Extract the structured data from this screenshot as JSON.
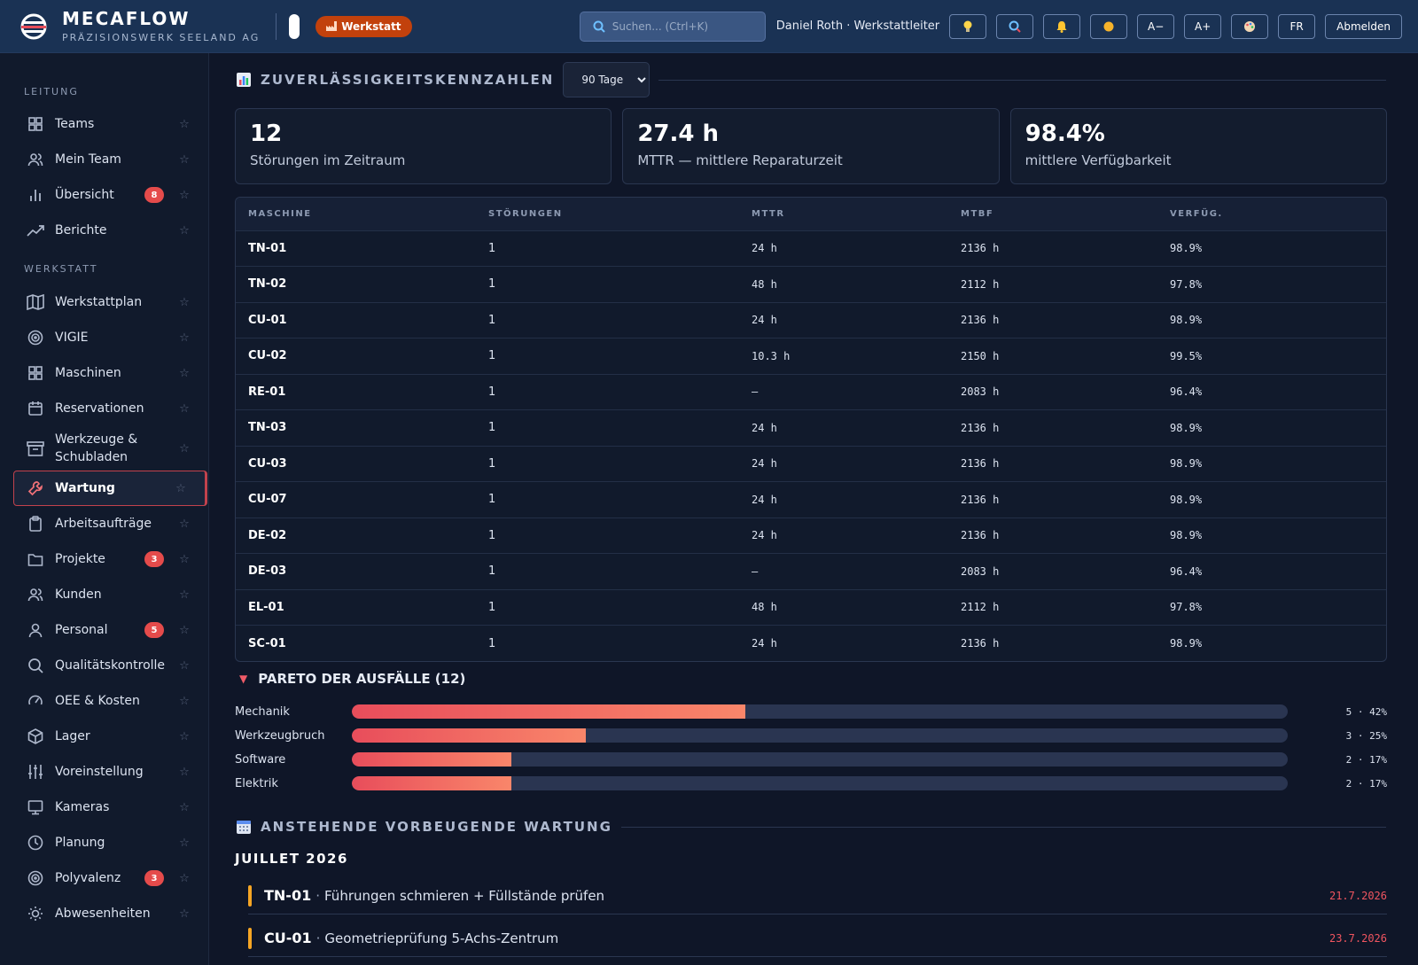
{
  "app": {
    "brand_name": "MECAFLOW",
    "brand_subtitle": "PRÄZISIONSWERK SEELAND AG",
    "context_badge": "Werkstatt",
    "search_placeholder": "Suchen... (Ctrl+K)",
    "user": "Daniel Roth · Werkstattleiter",
    "buttons": {
      "tips": "lightbulb",
      "search": "magnifier",
      "notifications": "bell",
      "theme": "sun",
      "font_smaller": "A−",
      "font_larger": "A+",
      "palette": "palette",
      "language": "FR",
      "logout": "Abmelden"
    }
  },
  "sidebar": {
    "sections": [
      {
        "label": "LEITUNG",
        "items": [
          {
            "label": "Teams",
            "icon": "grid-icon"
          },
          {
            "label": "Mein Team",
            "icon": "users-icon"
          },
          {
            "label": "Übersicht",
            "icon": "bar-chart-icon",
            "badge": "8"
          },
          {
            "label": "Berichte",
            "icon": "trend-icon"
          }
        ]
      },
      {
        "label": "WERKSTATT",
        "items": [
          {
            "label": "Werkstattplan",
            "icon": "map-icon"
          },
          {
            "label": "VIGIE",
            "icon": "target-icon"
          },
          {
            "label": "Maschinen",
            "icon": "grid-icon"
          },
          {
            "label": "Reservationen",
            "icon": "calendar-icon"
          },
          {
            "label": "Werkzeuge & Schubladen",
            "icon": "archive-icon"
          },
          {
            "label": "Wartung",
            "icon": "wrench-icon",
            "active": true
          },
          {
            "label": "Arbeitsaufträge",
            "icon": "clipboard-icon"
          },
          {
            "label": "Projekte",
            "icon": "folder-icon",
            "badge": "3"
          },
          {
            "label": "Kunden",
            "icon": "users-icon"
          },
          {
            "label": "Personal",
            "icon": "user-icon",
            "badge": "5"
          },
          {
            "label": "Qualitätskontrolle",
            "icon": "search-icon"
          },
          {
            "label": "OEE & Kosten",
            "icon": "gauge-icon"
          },
          {
            "label": "Lager",
            "icon": "box-icon"
          },
          {
            "label": "Voreinstellung",
            "icon": "sliders-icon"
          },
          {
            "label": "Kameras",
            "icon": "monitor-icon"
          },
          {
            "label": "Planung",
            "icon": "clock-icon"
          },
          {
            "label": "Polyvalenz",
            "icon": "target-icon",
            "badge": "3"
          },
          {
            "label": "Abwesenheiten",
            "icon": "sun-icon"
          }
        ]
      }
    ]
  },
  "reliability": {
    "title": "ZUVERLÄSSIGKEITSKENNZAHLEN",
    "period_selected": "90 Tage",
    "kpis": [
      {
        "value": "12",
        "label": "Störungen im Zeitraum"
      },
      {
        "value": "27.4 h",
        "label": "MTTR — mittlere Reparaturzeit"
      },
      {
        "value": "98.4%",
        "label": "mittlere Verfügbarkeit"
      }
    ],
    "columns": [
      "MASCHINE",
      "STÖRUNGEN",
      "MTTR",
      "MTBF",
      "VERFÜG."
    ],
    "rows": [
      [
        "TN-01",
        "1",
        "24 h",
        "2136 h",
        "98.9%"
      ],
      [
        "TN-02",
        "1",
        "48 h",
        "2112 h",
        "97.8%"
      ],
      [
        "CU-01",
        "1",
        "24 h",
        "2136 h",
        "98.9%"
      ],
      [
        "CU-02",
        "1",
        "10.3 h",
        "2150 h",
        "99.5%"
      ],
      [
        "RE-01",
        "1",
        "—",
        "2083 h",
        "96.4%"
      ],
      [
        "TN-03",
        "1",
        "24 h",
        "2136 h",
        "98.9%"
      ],
      [
        "CU-03",
        "1",
        "24 h",
        "2136 h",
        "98.9%"
      ],
      [
        "CU-07",
        "1",
        "24 h",
        "2136 h",
        "98.9%"
      ],
      [
        "DE-02",
        "1",
        "24 h",
        "2136 h",
        "98.9%"
      ],
      [
        "DE-03",
        "1",
        "—",
        "2083 h",
        "96.4%"
      ],
      [
        "EL-01",
        "1",
        "48 h",
        "2112 h",
        "97.8%"
      ],
      [
        "SC-01",
        "1",
        "24 h",
        "2136 h",
        "98.9%"
      ]
    ]
  },
  "pareto": {
    "title": "PARETO DER AUSFÄLLE (12)",
    "rows": [
      {
        "label": "Mechanik",
        "share": 0.42,
        "value": "5 · 42%"
      },
      {
        "label": "Werkzeugbruch",
        "share": 0.25,
        "value": "3 · 25%"
      },
      {
        "label": "Software",
        "share": 0.17,
        "value": "2 · 17%"
      },
      {
        "label": "Elektrik",
        "share": 0.17,
        "value": "2 · 17%"
      }
    ]
  },
  "upcoming": {
    "title": "ANSTEHENDE VORBEUGENDE WARTUNG",
    "month": "JUILLET 2026",
    "items": [
      {
        "code": "TN-01",
        "desc": "Führungen schmieren + Füllstände prüfen",
        "date": "21.7.2026"
      },
      {
        "code": "CU-01",
        "desc": "Geometrieprüfung 5-Achs-Zentrum",
        "date": "23.7.2026"
      }
    ]
  },
  "colors": {
    "accent_red": "#e84d5b",
    "warn_orange": "#f5a524",
    "header_bg": "#1a3254",
    "bg": "#0f1628"
  }
}
